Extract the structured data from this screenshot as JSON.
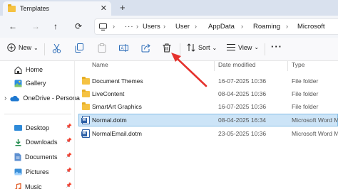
{
  "tab": {
    "title": "Templates",
    "close_glyph": "✕",
    "new_tab_glyph": "+"
  },
  "nav": {
    "back": "←",
    "forward": "→",
    "up": "↑",
    "refresh": "⟳",
    "more": "···"
  },
  "breadcrumbs": [
    "Users",
    "User",
    "AppData",
    "Roaming",
    "Microsoft"
  ],
  "toolbar": {
    "new_label": "New",
    "new_chevron": "⌄",
    "sort_label": "Sort",
    "sort_chevron": "⌄",
    "view_label": "View",
    "view_chevron": "⌄",
    "more": "···"
  },
  "sidebar": {
    "items": [
      {
        "label": "Home",
        "icon": "home-icon"
      },
      {
        "label": "Gallery",
        "icon": "gallery-icon"
      },
      {
        "label": "OneDrive - Persona",
        "icon": "onedrive-icon"
      },
      {
        "label": "Desktop",
        "icon": "desktop-icon"
      },
      {
        "label": "Downloads",
        "icon": "downloads-icon"
      },
      {
        "label": "Documents",
        "icon": "documents-icon"
      },
      {
        "label": "Pictures",
        "icon": "pictures-icon"
      },
      {
        "label": "Music",
        "icon": "music-icon"
      }
    ],
    "expand_glyph": "›",
    "pin_glyph": "📌"
  },
  "columns": {
    "name": "Name",
    "date": "Date modified",
    "type": "Type"
  },
  "files": [
    {
      "name": "Document Themes",
      "date": "16-07-2025 10:36",
      "type": "File folder",
      "kind": "folder"
    },
    {
      "name": "LiveContent",
      "date": "08-04-2025 10:36",
      "type": "File folder",
      "kind": "folder"
    },
    {
      "name": "SmartArt Graphics",
      "date": "16-07-2025 10:36",
      "type": "File folder",
      "kind": "folder"
    },
    {
      "name": "Normal.dotm",
      "date": "08-04-2025 16:34",
      "type": "Microsoft Word M",
      "kind": "word",
      "selected": true
    },
    {
      "name": "NormalEmail.dotm",
      "date": "23-05-2025 10:36",
      "type": "Microsoft Word M",
      "kind": "word"
    }
  ],
  "colors": {
    "accent": "#0067c0",
    "selection": "#cce4f7",
    "annotation_arrow": "#e5322d"
  }
}
